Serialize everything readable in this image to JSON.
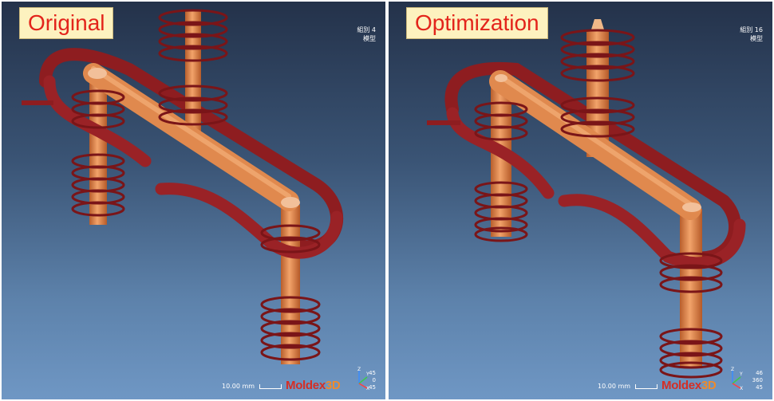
{
  "left": {
    "label": "Original",
    "meta_line1": "組別 4",
    "meta_line2": "模型",
    "scale": "10.00 mm",
    "brand_main": "Moldex",
    "brand_suffix": "3D",
    "angles": [
      "45",
      "0",
      "45"
    ]
  },
  "right": {
    "label": "Optimization",
    "meta_line1": "組別 16",
    "meta_line2": "模型",
    "scale": "10.00 mm",
    "brand_main": "Moldex",
    "brand_suffix": "3D",
    "angles": [
      "46",
      "360",
      "45"
    ]
  },
  "colors": {
    "runner": "#e0894e",
    "cooling_coil": "#8e1d20",
    "background_top": "#24324a",
    "background_bottom": "#6f97c4"
  },
  "axis_labels": [
    "Z",
    "Y",
    "X"
  ]
}
